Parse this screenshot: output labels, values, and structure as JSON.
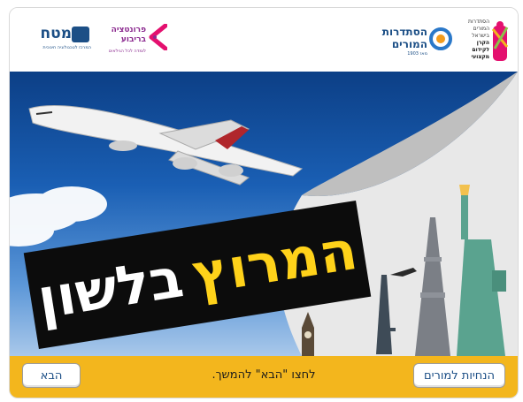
{
  "header": {
    "left_logo_text": "מטח",
    "left_logo_subtext": "המרכז לטכנולוגיה חינוכית",
    "center_left_logo_text": "פרונטציה בריבוע",
    "center_left_logo_subtext": "לומדה לכל הגילאים",
    "center_right_logo_text_line1": "הסתדרות",
    "center_right_logo_text_line2": "המורים",
    "center_right_logo_year": "מאז 1903",
    "right_logo_lines": [
      "הסתדרות",
      "המורים",
      "בישראל",
      "הקרן",
      "לקידום",
      "מקצועי"
    ]
  },
  "hero": {
    "title_word_1": "המרוץ",
    "title_word_2": "בלשון"
  },
  "footer": {
    "instruction": "לחצו \"הבא\" להמשך.",
    "teachers_button": "הנחיות למורים",
    "next_button": "הבא"
  },
  "colors": {
    "footer_bg": "#f3b61d",
    "title_accent": "#ffd21a",
    "banner_bg": "#0c0c0c",
    "brand_blue": "#1c4f86",
    "brand_pink": "#e4106f"
  }
}
